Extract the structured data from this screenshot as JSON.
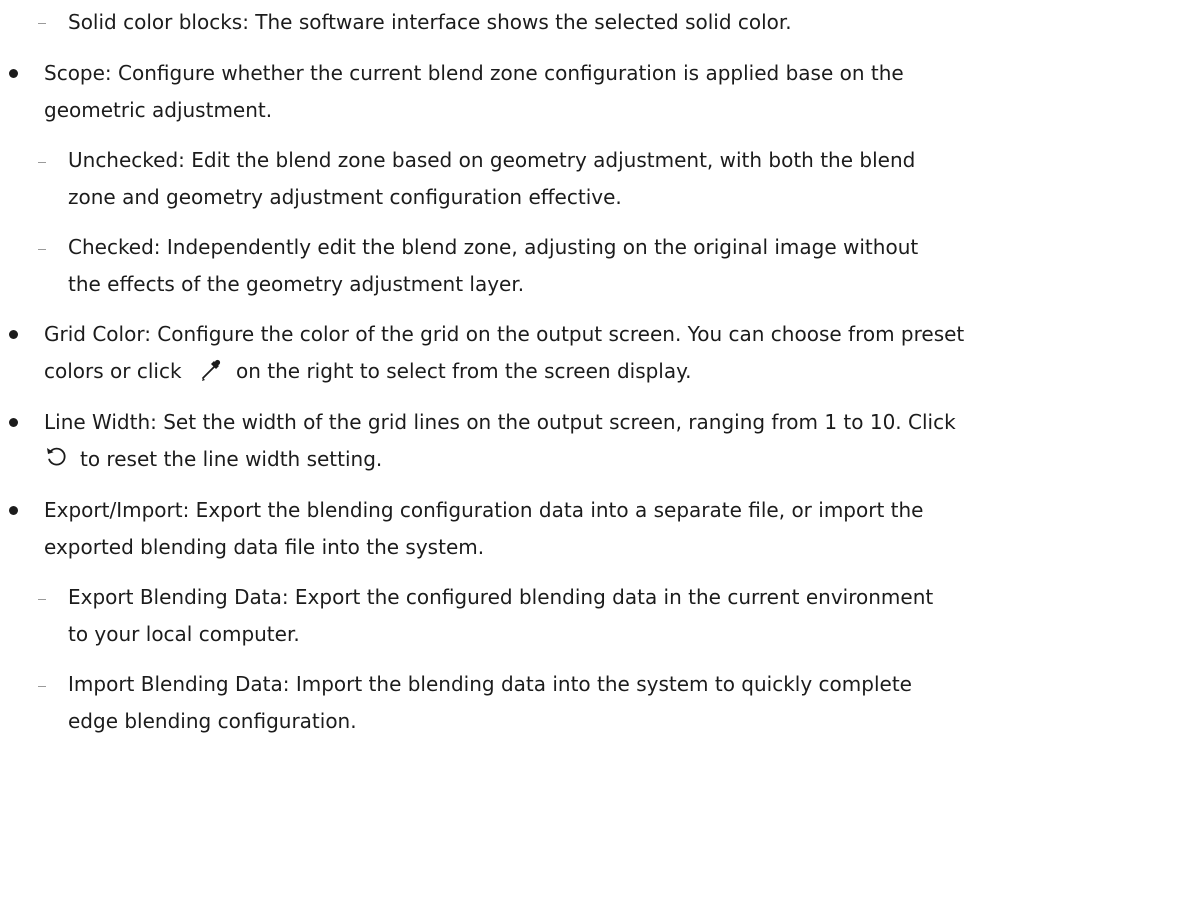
{
  "items": [
    {
      "kind": "sub",
      "text": "Solid color blocks: The software interface shows the selected solid color."
    },
    {
      "kind": "bullet",
      "lines": [
        "Scope: Configure whether the current blend zone configuration is applied base on the",
        "geometric adjustment."
      ]
    },
    {
      "kind": "sub",
      "lines": [
        "Unchecked: Edit the blend zone based on geometry adjustment, with both the blend",
        "zone and geometry adjustment configuration effective."
      ]
    },
    {
      "kind": "sub",
      "lines": [
        "Checked: Independently edit the blend zone, adjusting on the original image without",
        "the effects of the geometry adjustment layer."
      ]
    },
    {
      "kind": "bullet",
      "lines": [
        "Grid Color: Configure the color of the grid on the output screen. You can choose from preset",
        "colors or click",
        "on the right to select from the screen display."
      ],
      "icon": "eyedropper-icon"
    },
    {
      "kind": "bullet",
      "lines": [
        "Line Width: Set the width of the grid lines on the output screen, ranging from 1 to 10. Click",
        "to reset the line width setting."
      ],
      "icon": "reset-icon"
    },
    {
      "kind": "bullet",
      "lines": [
        "Export/Import: Export the blending configuration data into a separate file, or import the",
        "exported blending data file into the system."
      ]
    },
    {
      "kind": "sub",
      "lines": [
        "Export Blending Data: Export the configured blending data in the current environment",
        "to your local computer."
      ]
    },
    {
      "kind": "sub",
      "lines": [
        "Import Blending Data: Import the blending data into the system to quickly complete",
        "edge blending configuration."
      ]
    }
  ]
}
